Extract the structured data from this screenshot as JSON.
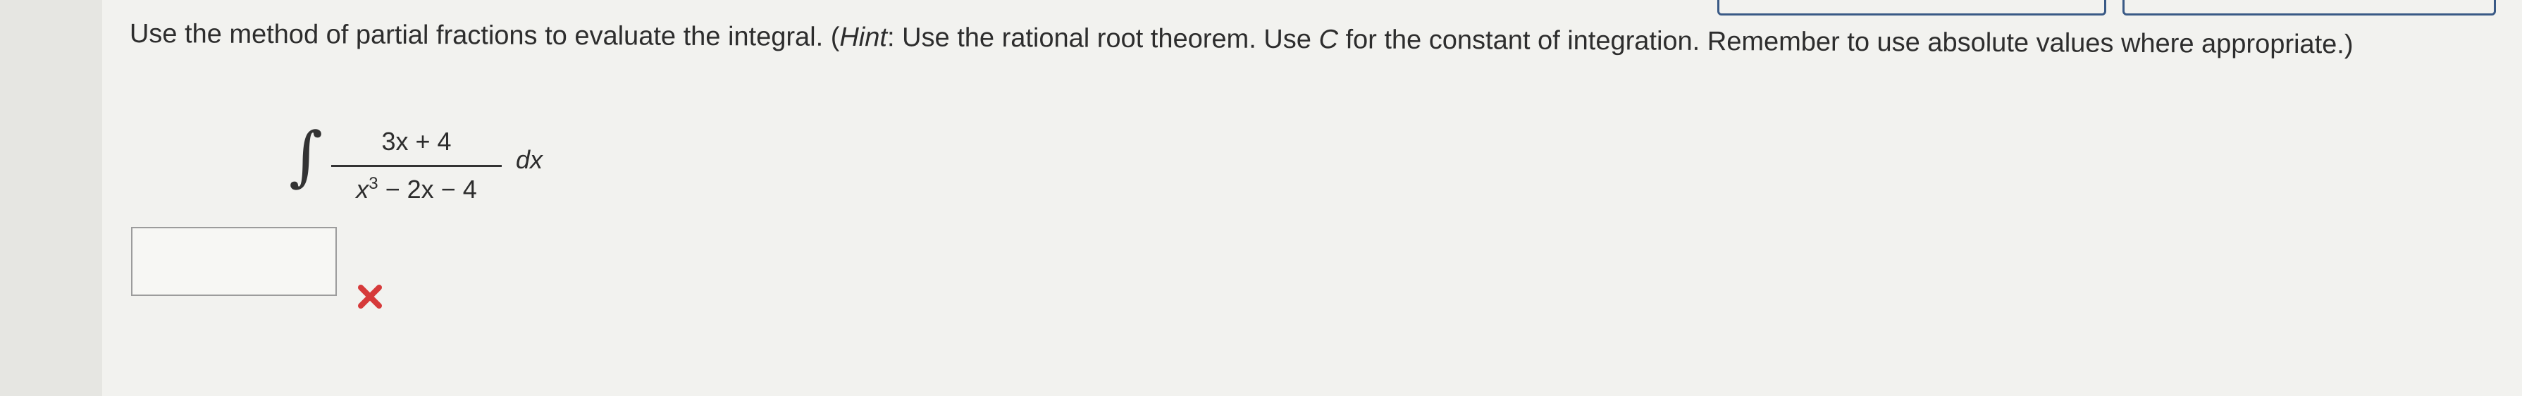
{
  "question": {
    "lead": "Use the method of partial fractions to evaluate the integral. (",
    "hint_label": "Hint",
    "hint_text": ": Use the rational root theorem. Use ",
    "constant_symbol": "C",
    "tail": " for the constant of integration. Remember to use absolute values where appropriate.)"
  },
  "integral": {
    "sign": "∫",
    "numerator": "3x + 4",
    "denominator_var": "x",
    "denominator_exp": "3",
    "denominator_rest": " − 2x − 4",
    "differential": "dx"
  },
  "answer": {
    "value": "",
    "placeholder": ""
  },
  "feedback": {
    "icon": "incorrect-x-icon",
    "color": "#d63a3a"
  }
}
